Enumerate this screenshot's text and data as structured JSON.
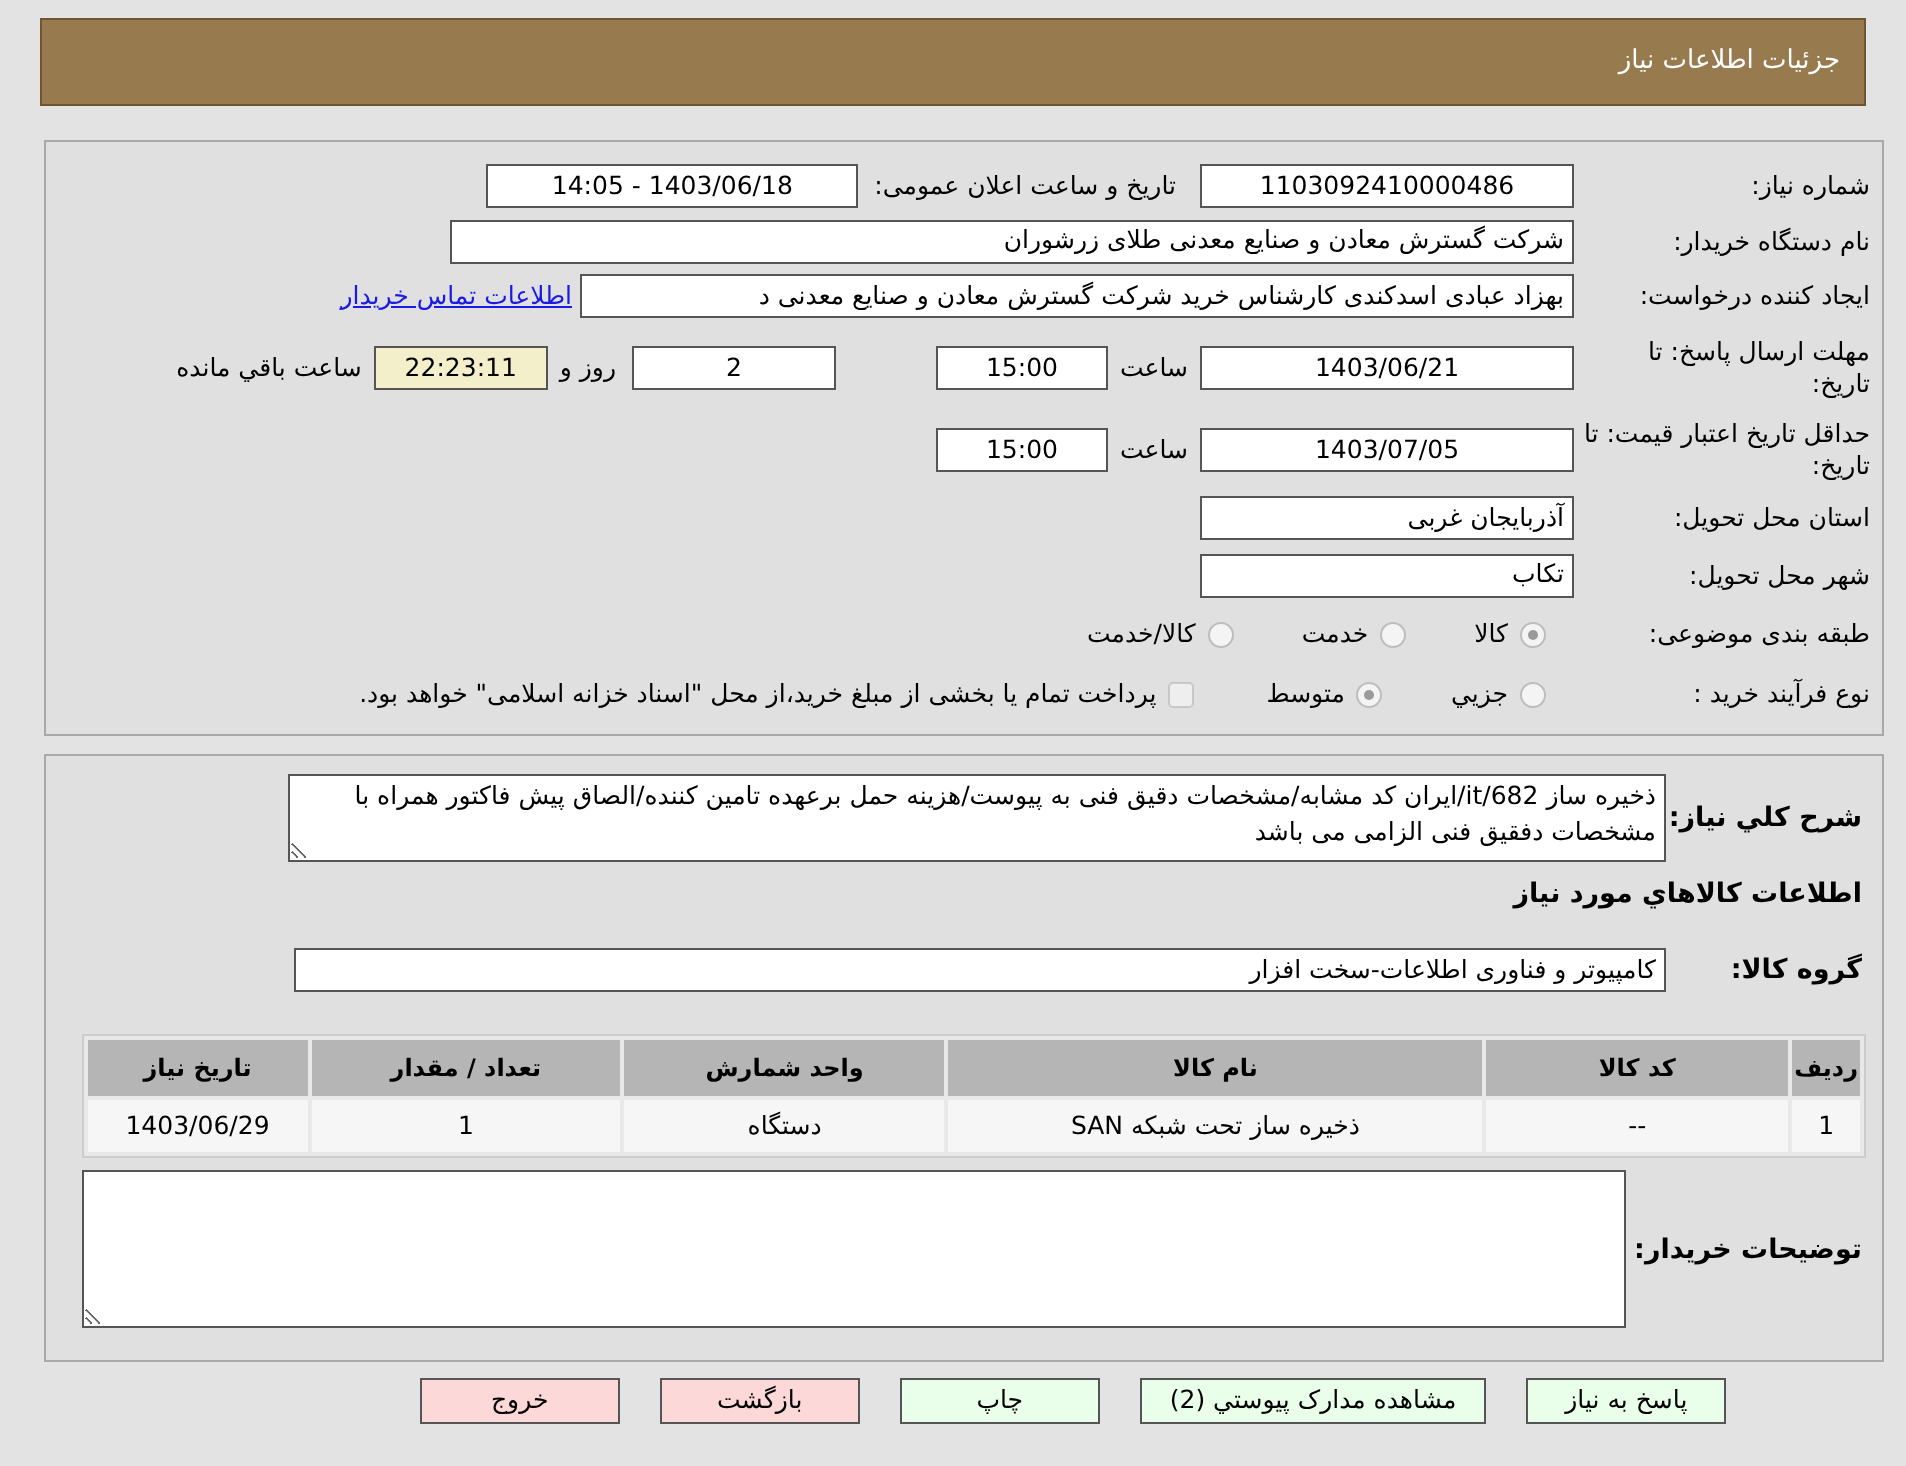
{
  "header": {
    "title": "جزئیات اطلاعات نیاز"
  },
  "need_number": {
    "label": "شماره نیاز:",
    "value": "1103092410000486"
  },
  "announce": {
    "label": "تاریخ و ساعت اعلان عمومی:",
    "value": "1403/06/18 - 14:05"
  },
  "buyer_org": {
    "label": "نام دستگاه خریدار:",
    "value": "شرکت گسترش معادن و صنایع معدنی طلای زرشوران"
  },
  "requester": {
    "label": "ایجاد کننده درخواست:",
    "value": "بهزاد عبادی اسدکندی کارشناس خرید  شرکت گسترش معادن و صنایع معدنی د",
    "link": "اطلاعات تماس خریدار"
  },
  "deadline": {
    "label": "مهلت ارسال پاسخ: تا تاریخ:",
    "date": "1403/06/21",
    "time_label": "ساعت",
    "time": "15:00",
    "days": "2",
    "days_label": "روز و",
    "countdown": "22:23:11",
    "remaining_label": "ساعت باقي مانده"
  },
  "validity": {
    "label": "حداقل تاریخ اعتبار قیمت: تا تاریخ:",
    "date": "1403/07/05",
    "time_label": "ساعت",
    "time": "15:00"
  },
  "province": {
    "label": "استان محل تحویل:",
    "value": "آذربایجان غربی"
  },
  "city": {
    "label": "شهر محل تحویل:",
    "value": "تکاب"
  },
  "category": {
    "label": "طبقه بندی موضوعی:",
    "options": [
      {
        "label": "کالا",
        "selected": true
      },
      {
        "label": "خدمت",
        "selected": false
      },
      {
        "label": "کالا/خدمت",
        "selected": false
      }
    ]
  },
  "process": {
    "label": "نوع فرآیند خرید :",
    "options": [
      {
        "label": "جزيي",
        "selected": false
      },
      {
        "label": "متوسط",
        "selected": true
      }
    ],
    "payment": {
      "checked": false,
      "text": "پرداخت تمام یا بخشی از مبلغ خرید،از محل \"اسناد خزانه اسلامی\" خواهد بود."
    }
  },
  "description": {
    "label": "شرح كلي نياز:",
    "value": "ذخیره ساز it/682/ایران کد مشابه/مشخصات دقیق فنی به پیوست/هزینه حمل برعهده تامین کننده/الصاق پیش فاکتور همراه با مشخصات دفقیق فنی الزامی می باشد"
  },
  "items_heading": "اطلاعات كالاهاي مورد نياز",
  "goods_group": {
    "label": "گروه کالا:",
    "value": "کامپیوتر و فناوری اطلاعات-سخت افزار"
  },
  "table": {
    "columns": [
      "ردیف",
      "کد کالا",
      "نام کالا",
      "واحد شمارش",
      "تعداد / مقدار",
      "تاریخ نیاز"
    ],
    "rows": [
      [
        "1",
        "--",
        "ذخیره ساز تحت شبکه SAN",
        "دستگاه",
        "1",
        "1403/06/29"
      ]
    ]
  },
  "buyer_notes": {
    "label": "توضیحات خریدار:"
  },
  "buttons": [
    {
      "label": "پاسخ به نیاز",
      "kind": "normal"
    },
    {
      "label": "مشاهده مدارک پیوستي (2)",
      "kind": "normal"
    },
    {
      "label": "چاپ",
      "kind": "normal"
    },
    {
      "label": "بازگشت",
      "kind": "danger"
    },
    {
      "label": "خروج",
      "kind": "danger"
    }
  ]
}
